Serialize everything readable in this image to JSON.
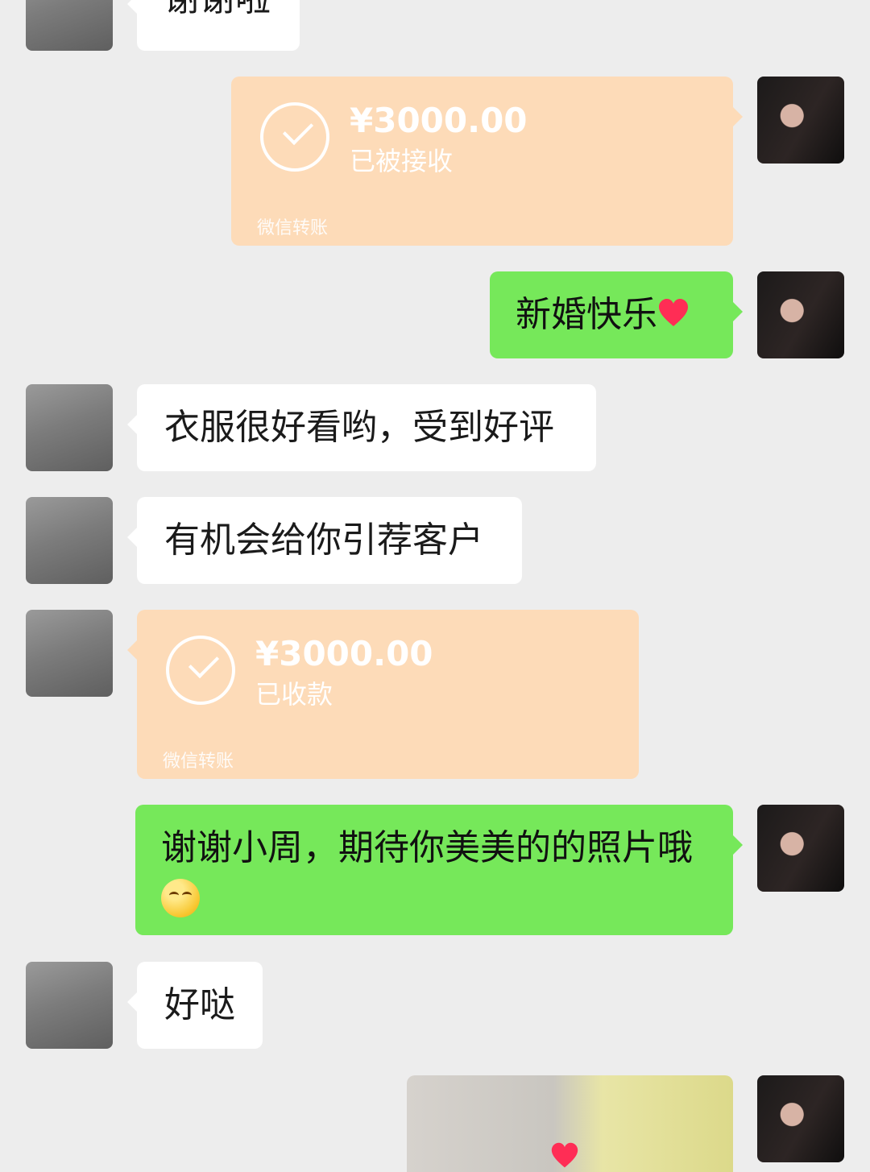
{
  "messages": {
    "m1": {
      "text": "谢谢啦"
    },
    "m2": {
      "amount": "¥3000.00",
      "status": "已被接收",
      "brand": "微信转账"
    },
    "m3": {
      "text": "新婚快乐"
    },
    "m4": {
      "text": "衣服很好看哟，受到好评"
    },
    "m5": {
      "text": "有机会给你引荐客户"
    },
    "m6": {
      "amount": "¥3000.00",
      "status": "已收款",
      "brand": "微信转账"
    },
    "m7": {
      "text": "谢谢小周，期待你美美的的照片哦"
    },
    "m8": {
      "text": "好哒"
    }
  },
  "icons": {
    "heart": "red-heart-emoji",
    "smile": "grinning-emoji",
    "check": "check-circle-icon"
  },
  "colors": {
    "green_bubble": "#76e85a",
    "transfer_bubble": "#fddbb8",
    "background": "#ededed"
  }
}
